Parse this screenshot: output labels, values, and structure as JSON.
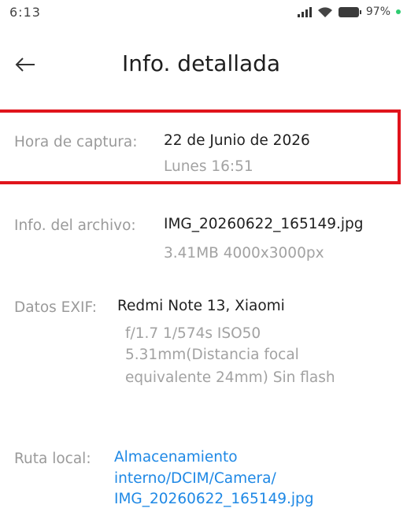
{
  "status_bar": {
    "time": "6:13",
    "battery_text": "97%"
  },
  "header": {
    "title": "Info. detallada",
    "back_icon": "arrow-left-icon"
  },
  "details": {
    "capture": {
      "label": "Hora de captura:",
      "date": "22 de Junio de 2026",
      "day_time": "Lunes   16:51"
    },
    "file": {
      "label": "Info. del archivo:",
      "name": "IMG_20260622_165149.jpg",
      "meta": "3.41MB   4000x3000px"
    },
    "exif": {
      "label": "Datos EXIF:",
      "device": "Redmi Note 13, Xiaomi",
      "line1": "f/1.7    1/574s    ISO50",
      "line2": "5.31mm(Distancia focal",
      "line3": "equivalente 24mm)    Sin flash"
    },
    "path": {
      "label": "Ruta local:",
      "line1": "Almacenamiento",
      "line2": "interno/DCIM/Camera/",
      "line3": "IMG_20260622_165149.jpg"
    }
  },
  "colors": {
    "highlight": "#e0141c",
    "link": "#1e88e5",
    "label": "#9a9a9a",
    "charging": "#2ecc71"
  }
}
